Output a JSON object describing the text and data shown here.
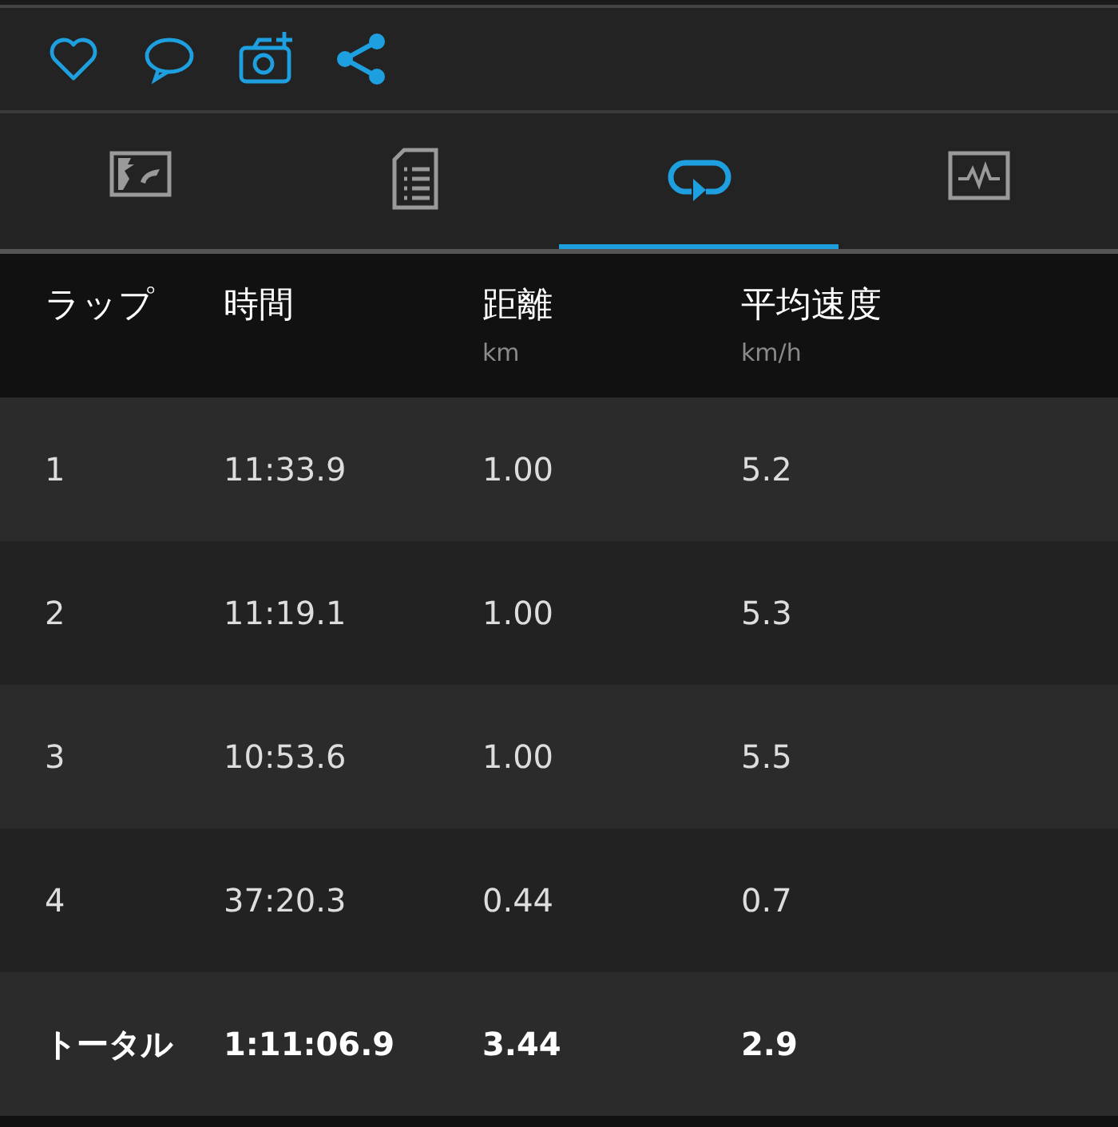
{
  "actions": [
    {
      "kind": "heart"
    },
    {
      "kind": "comment"
    },
    {
      "kind": "camera"
    },
    {
      "kind": "share"
    }
  ],
  "tabs": [
    {
      "kind": "map",
      "selected": false
    },
    {
      "kind": "details",
      "selected": false
    },
    {
      "kind": "laps",
      "selected": true
    },
    {
      "kind": "chart",
      "selected": false
    }
  ],
  "table": {
    "columns": [
      {
        "label": "ラップ"
      },
      {
        "label": "時間"
      },
      {
        "label": "距離",
        "unit": "km"
      },
      {
        "label": "平均速度",
        "unit": "km/h"
      }
    ],
    "rows": [
      {
        "cells": [
          "1",
          "11:33.9",
          "1.00",
          "5.2"
        ]
      },
      {
        "cells": [
          "2",
          "11:19.1",
          "1.00",
          "5.3"
        ]
      },
      {
        "cells": [
          "3",
          "10:53.6",
          "1.00",
          "5.5"
        ]
      },
      {
        "cells": [
          "4",
          "37:20.3",
          "0.44",
          "0.7"
        ]
      }
    ],
    "total": {
      "cells": [
        "トータル",
        "1:11:06.9",
        "3.44",
        "2.9"
      ]
    }
  }
}
